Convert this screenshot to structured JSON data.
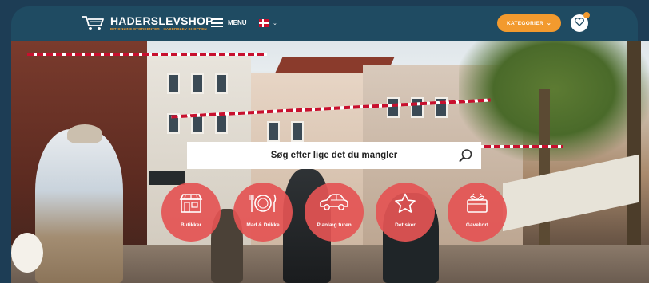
{
  "header": {
    "logo_name": "HADERSLEVSHOP",
    "logo_tagline": "DIT ONLINE STORCENTER · HADERSLEV SHOPPEN",
    "menu_label": "MENU",
    "language": "Dansk",
    "categories_button": "KATEGORIER"
  },
  "search": {
    "placeholder": "Søg efter lige det du mangler"
  },
  "categories": [
    {
      "label": "Butikker",
      "icon": "shop-icon"
    },
    {
      "label": "Mad & Drikke",
      "icon": "plate-cutlery-icon"
    },
    {
      "label": "Planlæg turen",
      "icon": "car-icon"
    },
    {
      "label": "Det sker",
      "icon": "star-icon"
    },
    {
      "label": "Gavekort",
      "icon": "gift-card-icon"
    }
  ],
  "colors": {
    "header_bg": "#1f4b62",
    "accent_orange": "#f29a2e",
    "category_red": "#e45454"
  }
}
